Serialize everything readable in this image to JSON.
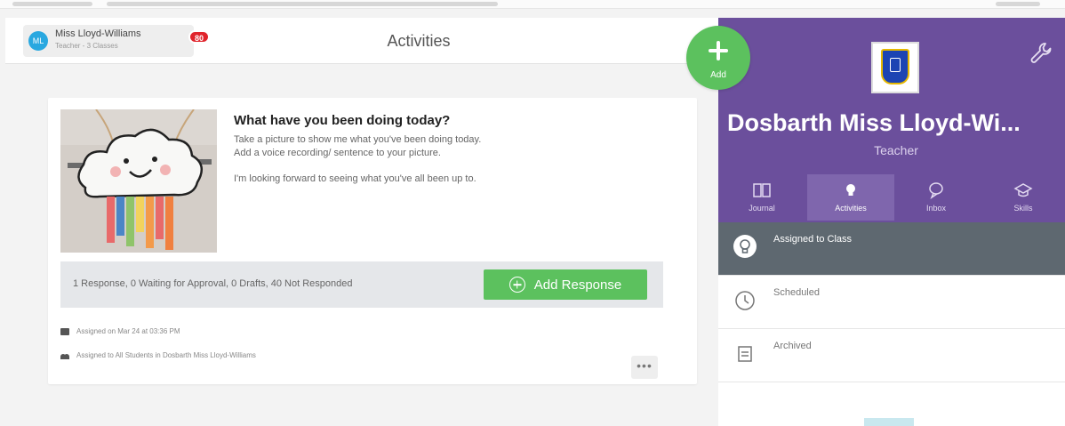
{
  "user": {
    "initials": "ML",
    "name": "Miss Lloyd-Williams",
    "subtitle": "Teacher - 3 Classes",
    "notification_count": "80"
  },
  "page": {
    "title": "Activities"
  },
  "activity": {
    "title": "What have you been doing today?",
    "description_lines": [
      "Take a picture to show me what you've been doing today.",
      "Add a voice recording/ sentence to your picture.",
      "I'm looking forward to seeing what you've all been up to."
    ],
    "response_summary": "1 Response, 0 Waiting for Approval, 0 Drafts, 40 Not Responded",
    "add_response_label": "Add Response",
    "assigned_date": "Assigned on Mar 24 at 03:36 PM",
    "assigned_to": "Assigned to All Students in Dosbarth Miss Lloyd-Williams",
    "more_label": "•••"
  },
  "fab": {
    "label": "Add"
  },
  "panel": {
    "class_name": "Dosbarth Miss Lloyd-Wi...",
    "role": "Teacher",
    "tabs": [
      {
        "label": "Journal",
        "icon": "book-icon"
      },
      {
        "label": "Activities",
        "icon": "lightbulb-icon"
      },
      {
        "label": "Inbox",
        "icon": "chat-icon"
      },
      {
        "label": "Skills",
        "icon": "graduation-cap-icon"
      }
    ],
    "list": [
      {
        "label": "Assigned to Class",
        "icon": "lightbulb-icon"
      },
      {
        "label": "Scheduled",
        "icon": "clock-icon"
      },
      {
        "label": "Archived",
        "icon": "archive-icon"
      }
    ]
  },
  "colors": {
    "brand_purple": "#6b4f9c",
    "active_tab": "#7f66ad",
    "green": "#5cc15e",
    "badge_red": "#e0242c",
    "active_list": "#5e6870"
  }
}
